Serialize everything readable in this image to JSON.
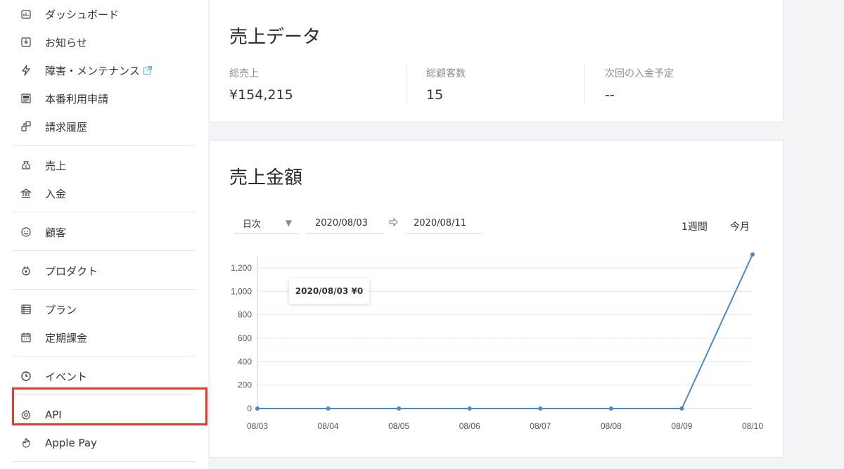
{
  "sidebar": {
    "groups": [
      [
        {
          "label": "ダッシュボード",
          "icon": "dashboard-icon"
        },
        {
          "label": "お知らせ",
          "icon": "inbox-icon"
        },
        {
          "label": "障害・メンテナンス",
          "icon": "lightning-icon",
          "external": true
        },
        {
          "label": "本番利用申請",
          "icon": "document-icon"
        },
        {
          "label": "請求履歴",
          "icon": "billing-icon"
        }
      ],
      [
        {
          "label": "売上",
          "icon": "money-bag-icon"
        },
        {
          "label": "入金",
          "icon": "bank-icon"
        }
      ],
      [
        {
          "label": "顧客",
          "icon": "smiley-icon"
        }
      ],
      [
        {
          "label": "プロダクト",
          "icon": "box-icon"
        }
      ],
      [
        {
          "label": "プラン",
          "icon": "list-icon"
        },
        {
          "label": "定期課金",
          "icon": "calendar-icon"
        }
      ],
      [
        {
          "label": "イベント",
          "icon": "clock-icon"
        }
      ],
      [
        {
          "label": "API",
          "icon": "gear-icon"
        },
        {
          "label": "Apple Pay",
          "icon": "hand-icon"
        }
      ]
    ]
  },
  "sales_summary": {
    "title": "売上データ",
    "stats": [
      {
        "label": "総売上",
        "value": "¥154,215"
      },
      {
        "label": "総顧客数",
        "value": "15"
      },
      {
        "label": "次回の入金予定",
        "value": "--"
      }
    ]
  },
  "sales_chart_card": {
    "title": "売上金額",
    "interval_select": "日次",
    "date_from": "2020/08/03",
    "date_to": "2020/08/11",
    "range_buttons": [
      "1週間",
      "今月"
    ],
    "tooltip": "2020/08/03 ¥0"
  },
  "colors": {
    "accent": "#4a8ac9",
    "highlight": "#e8392a"
  },
  "chart_data": {
    "type": "line",
    "x": [
      "08/03",
      "08/04",
      "08/05",
      "08/06",
      "08/07",
      "08/08",
      "08/09",
      "08/10"
    ],
    "series": [
      {
        "values": [
          0,
          0,
          0,
          0,
          0,
          0,
          0,
          1315
        ]
      }
    ],
    "yticks": [
      "0",
      "200",
      "400",
      "600",
      "800",
      "1,000",
      "1,200"
    ],
    "ylim": [
      0,
      1300
    ],
    "grid": true
  }
}
